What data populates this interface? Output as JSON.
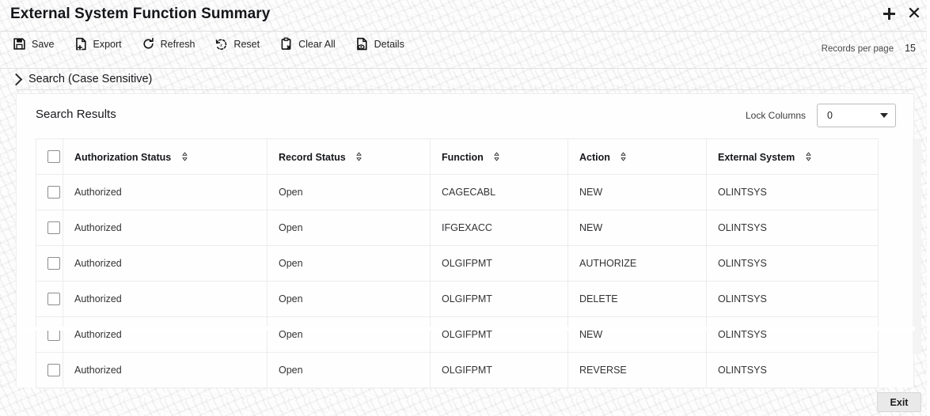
{
  "window": {
    "title": "External System Function Summary",
    "collapse_icon": "collapse-restore-icon",
    "close_icon": "close-icon"
  },
  "toolbar": {
    "items": [
      {
        "label": "Save",
        "icon": "save-floppy-icon"
      },
      {
        "label": "Export",
        "icon": "export-document-icon"
      },
      {
        "label": "Refresh",
        "icon": "refresh-circular-arrow-icon"
      },
      {
        "label": "Reset",
        "icon": "reset-circular-arrow-x-icon"
      },
      {
        "label": "Clear All",
        "icon": "clipboard-x-icon"
      },
      {
        "label": "Details",
        "icon": "document-eye-icon"
      }
    ],
    "records_per_page_label": "Records per page",
    "records_per_page_value": "15"
  },
  "search_section": {
    "label": "Search (Case Sensitive)",
    "expanded": false,
    "chevron_icon": "chevron-right-icon"
  },
  "results": {
    "title": "Search Results",
    "lock_columns_label": "Lock Columns",
    "lock_columns_value": "0",
    "lock_columns_caret_icon": "chevron-down-icon",
    "select_all_checkbox": false,
    "columns": [
      {
        "key": "checkbox",
        "label": "",
        "sortable": false
      },
      {
        "key": "auth",
        "label": "Authorization Status",
        "sortable": true
      },
      {
        "key": "record",
        "label": "Record Status",
        "sortable": true
      },
      {
        "key": "function",
        "label": "Function",
        "sortable": true
      },
      {
        "key": "action",
        "label": "Action",
        "sortable": true
      },
      {
        "key": "external",
        "label": "External System",
        "sortable": true
      }
    ],
    "rows": [
      {
        "auth": "Authorized",
        "record": "Open",
        "function": "CAGECABL",
        "action": "NEW",
        "external": "OLINTSYS",
        "checked": false
      },
      {
        "auth": "Authorized",
        "record": "Open",
        "function": "IFGEXACC",
        "action": "NEW",
        "external": "OLINTSYS",
        "checked": false
      },
      {
        "auth": "Authorized",
        "record": "Open",
        "function": "OLGIFPMT",
        "action": "AUTHORIZE",
        "external": "OLINTSYS",
        "checked": false
      },
      {
        "auth": "Authorized",
        "record": "Open",
        "function": "OLGIFPMT",
        "action": "DELETE",
        "external": "OLINTSYS",
        "checked": false
      },
      {
        "auth": "Authorized",
        "record": "Open",
        "function": "OLGIFPMT",
        "action": "NEW",
        "external": "OLINTSYS",
        "checked": false
      },
      {
        "auth": "Authorized",
        "record": "Open",
        "function": "OLGIFPMT",
        "action": "REVERSE",
        "external": "OLINTSYS",
        "checked": false
      }
    ]
  },
  "footer": {
    "exit_label": "Exit"
  },
  "colors": {
    "page_bg": "#fdfdfd",
    "card_bg": "#fefefe",
    "text": "#1b1b1b",
    "muted_text": "#4a4a4a",
    "grid_line": "#ececec",
    "button_bg": "#e9e9e9"
  }
}
